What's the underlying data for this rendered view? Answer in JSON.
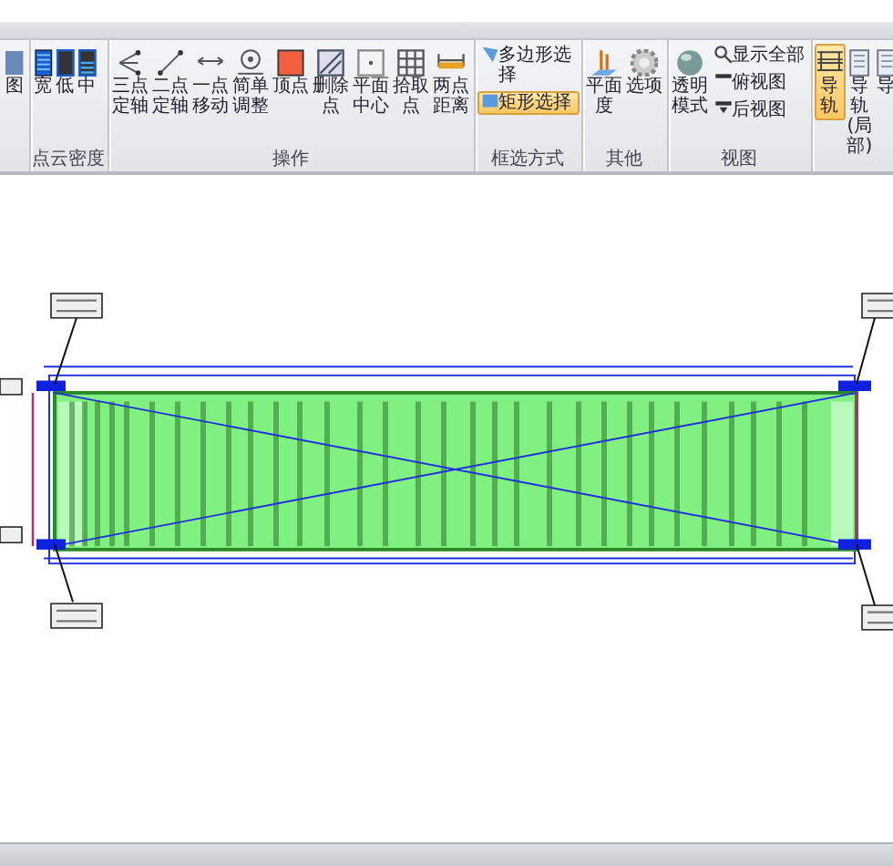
{
  "ribbon": {
    "groups": [
      {
        "buttons": [
          {
            "label": "图",
            "kind": "partial",
            "selected": false
          }
        ]
      },
      {
        "label": "点云密度",
        "buttons": [
          {
            "label": "宽",
            "kind": "density-wide",
            "selected": false
          },
          {
            "label": "低",
            "kind": "density-low",
            "selected": false
          },
          {
            "label": "中",
            "kind": "density-mid",
            "selected": false
          }
        ]
      },
      {
        "label": "操作",
        "buttons": [
          {
            "label": "三点定轴",
            "kind": "three-point",
            "selected": false
          },
          {
            "label": "二点定轴",
            "kind": "two-point",
            "selected": false
          },
          {
            "label": "一点移动",
            "kind": "one-point",
            "selected": false
          },
          {
            "label": "简单调整",
            "kind": "adjust",
            "selected": false
          },
          {
            "label": "顶点",
            "kind": "vertex",
            "selected": false
          },
          {
            "label": "删除点",
            "kind": "delete",
            "selected": false
          },
          {
            "label": "平面中心",
            "kind": "center",
            "selected": false
          },
          {
            "label": "拾取点",
            "kind": "grid",
            "selected": false
          },
          {
            "label": "两点距离",
            "kind": "distance",
            "selected": false
          }
        ]
      },
      {
        "label": "框选方式",
        "buttons": [
          {
            "label": "多边形选择",
            "kind": "polygon",
            "selected": false
          },
          {
            "label": "矩形选择",
            "kind": "rect",
            "selected": true
          }
        ]
      },
      {
        "label": "其他",
        "buttons": [
          {
            "label": "平面度",
            "kind": "flatness",
            "selected": false
          },
          {
            "label": "选项",
            "kind": "options",
            "selected": false
          }
        ]
      },
      {
        "label": "视图",
        "buttons": [
          {
            "label": "透明模式",
            "kind": "sphere",
            "selected": false
          },
          {
            "label": "显示全部",
            "kind": "show-all",
            "selected": false
          },
          {
            "label": "俯视图",
            "kind": "top-view",
            "selected": false
          },
          {
            "label": "后视图",
            "kind": "back-view",
            "selected": false
          }
        ]
      },
      {
        "buttons": [
          {
            "label": "导轨",
            "kind": "rail",
            "selected": true
          },
          {
            "label": "导轨(局部)",
            "kind": "rail-local",
            "selected": false
          },
          {
            "label": "导",
            "kind": "rail-local",
            "selected": false
          }
        ]
      }
    ]
  }
}
